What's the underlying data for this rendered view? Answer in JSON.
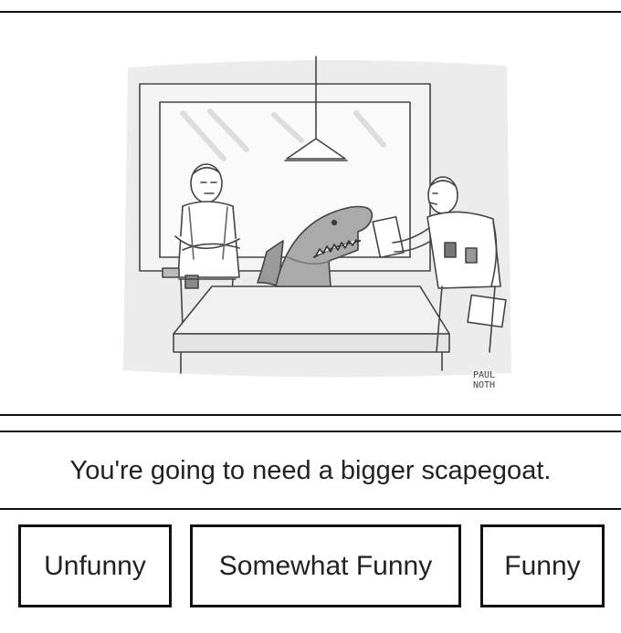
{
  "cartoon": {
    "signature_line1": "PAUL",
    "signature_line2": "NOTH"
  },
  "caption": {
    "text": "You're going to need a bigger scapegoat."
  },
  "ratings": {
    "unfunny_label": "Unfunny",
    "somewhat_funny_label": "Somewhat Funny",
    "funny_label": "Funny"
  }
}
